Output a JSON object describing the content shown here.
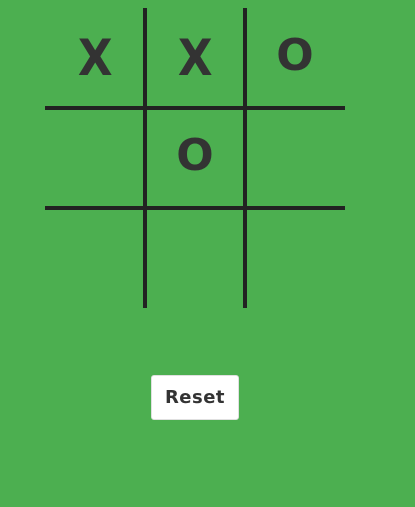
{
  "board": {
    "cells": [
      "X",
      "X",
      "O",
      "",
      "O",
      "",
      "",
      "",
      ""
    ]
  },
  "reset_button": {
    "label": "Reset"
  },
  "colors": {
    "background": "#4caf50",
    "mark": "#333333",
    "grid_line": "#222222",
    "button_background": "#ffffff"
  }
}
